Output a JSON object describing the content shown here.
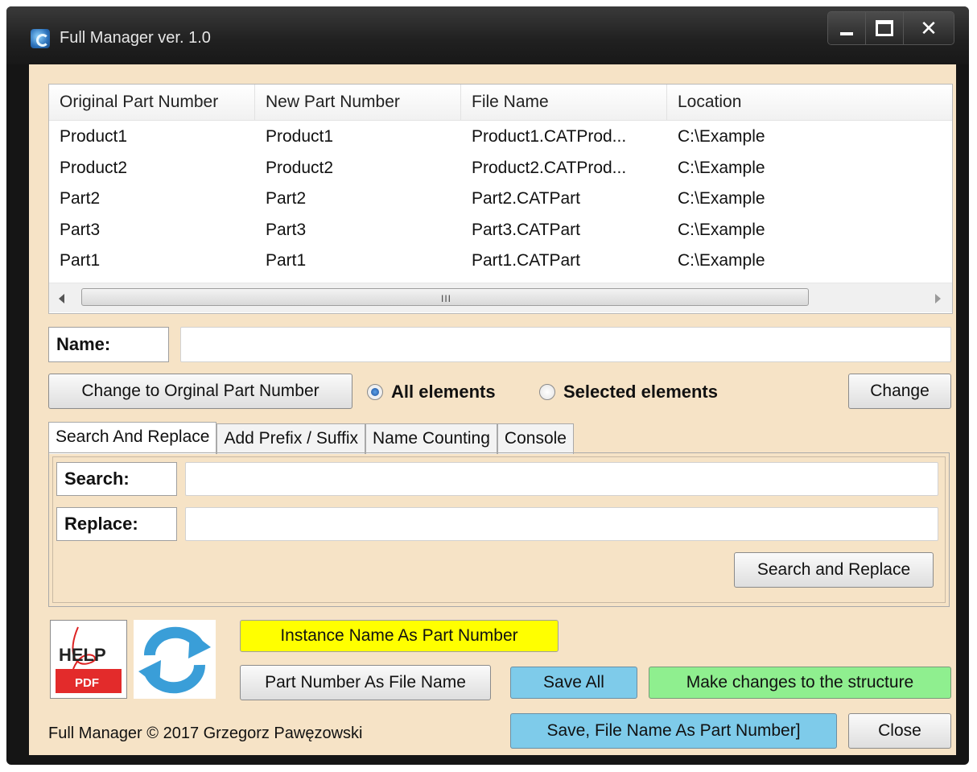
{
  "window": {
    "title": "Full Manager ver. 1.0"
  },
  "table": {
    "columns": [
      "Original Part Number",
      "New Part Number",
      "File Name",
      "Location"
    ],
    "rows": [
      [
        "Product1",
        "Product1",
        "Product1.CATProd...",
        "C:\\Example"
      ],
      [
        "Product2",
        "Product2",
        "Product2.CATProd...",
        "C:\\Example"
      ],
      [
        "Part2",
        "Part2",
        "Part2.CATPart",
        "C:\\Example"
      ],
      [
        "Part3",
        "Part3",
        "Part3.CATPart",
        "C:\\Example"
      ],
      [
        "Part1",
        "Part1",
        "Part1.CATPart",
        "C:\\Example"
      ]
    ],
    "scroll_grip": "III"
  },
  "name_field": {
    "label": "Name:",
    "value": ""
  },
  "controls": {
    "change_original_label": "Change to Orginal Part Number",
    "radio_all_label": "All elements",
    "radio_selected_label": "Selected elements",
    "selected_radio": "All elements",
    "change_label": "Change"
  },
  "tabs": [
    "Search And Replace",
    "Add Prefix / Suffix",
    "Name Counting",
    "Console"
  ],
  "active_tab": "Search And Replace",
  "search_replace": {
    "search_label": "Search:",
    "search_value": "",
    "replace_label": "Replace:",
    "replace_value": "",
    "button_label": "Search and Replace"
  },
  "bottom": {
    "help_icon_text": "HELP",
    "help_icon_sub": "PDF",
    "instance_name_label": "Instance Name As Part Number",
    "part_number_file_label": "Part Number As File Name",
    "save_all_label": "Save All",
    "make_changes_label": "Make changes to the structure",
    "save_file_name_label": "Save, File Name As Part Number]",
    "close_label": "Close",
    "footer_text": "Full Manager © 2017 Grzegorz Pawęzowski"
  },
  "colors": {
    "background": "#f6e3c6",
    "yellow_button": "#ffff00",
    "blue_button": "#7ecbea",
    "green_button": "#8fef8f"
  }
}
